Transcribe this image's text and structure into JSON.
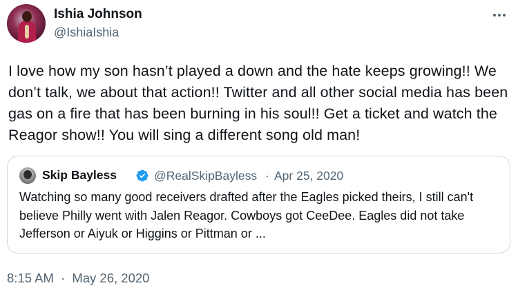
{
  "tweet": {
    "display_name": "Ishia Johnson",
    "handle": "@IshiaIshia",
    "text": "I love how my son hasn’t played a down and the hate keeps growing!! We don’t talk, we about that action!! Twitter and all other social media has been gas on a fire that has been burning in his soul!! Get a ticket and watch the Reagor show!! You will sing a different song old man!",
    "time": "8:15 AM",
    "separator": "·",
    "date": "May 26, 2020",
    "more_icon": "more-horizontal-icon"
  },
  "quote": {
    "display_name": "Skip Bayless",
    "handle": "@RealSkipBayless",
    "separator": "·",
    "date": "Apr 25, 2020",
    "verified_icon": "verified-badge-icon",
    "text": "Watching so many good receivers drafted after the Eagles picked theirs, I still can't believe Philly went with Jalen Reagor. Cowboys got CeeDee. Eagles did not take Jefferson or Aiyuk or Higgins or Pittman or ..."
  },
  "colors": {
    "text_primary": "#0f1419",
    "text_secondary": "#536471",
    "border": "#cfd9de",
    "verified": "#1d9bf0"
  }
}
